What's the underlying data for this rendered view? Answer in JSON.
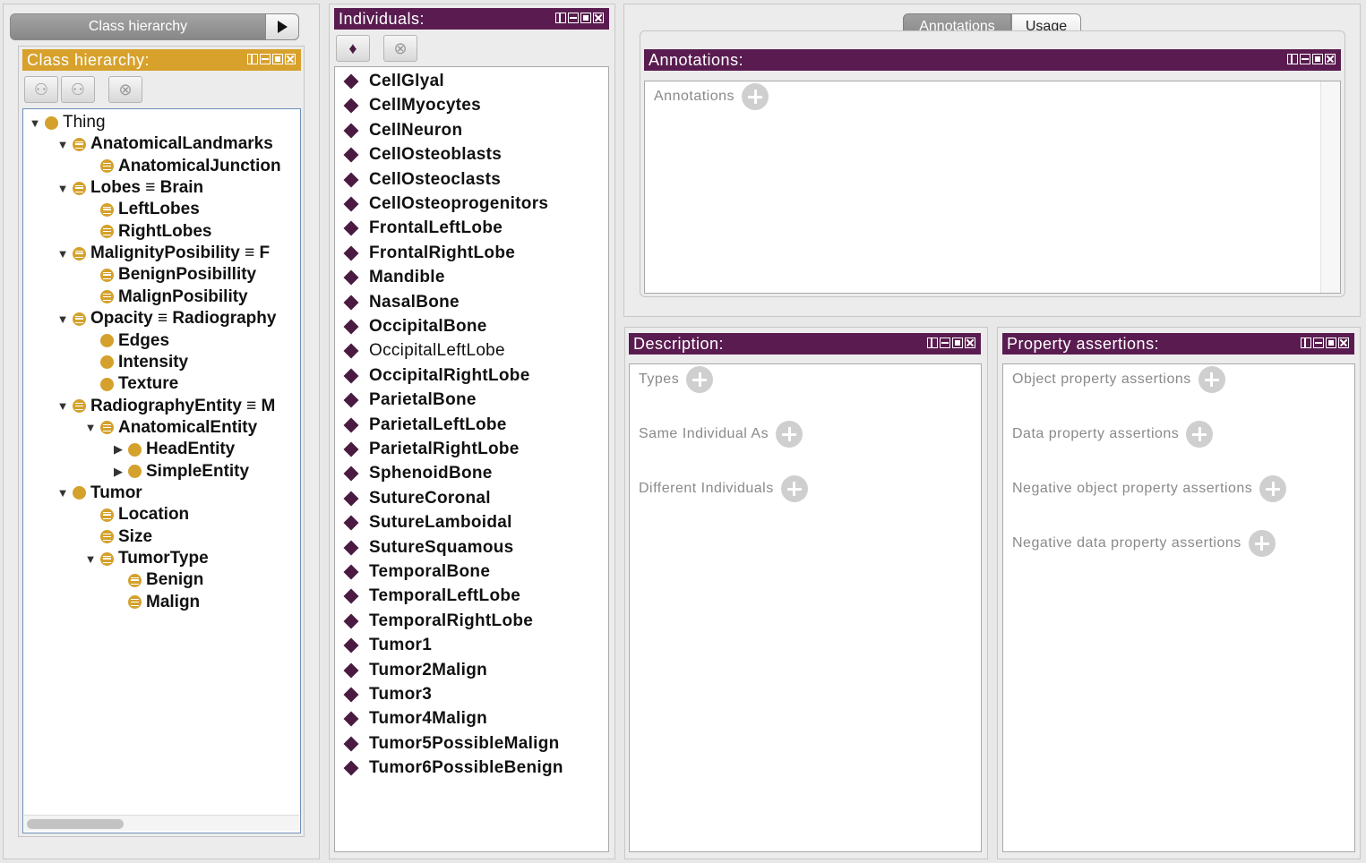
{
  "left_tab": {
    "label": "Class hierarchy"
  },
  "class_panel": {
    "title": "Class hierarchy:",
    "tree": [
      {
        "label": "Thing",
        "level": 0,
        "expander": "open",
        "dot": "plain",
        "bold": false
      },
      {
        "label": "AnatomicalLandmarks",
        "level": 1,
        "expander": "open",
        "dot": "eq",
        "bold": true
      },
      {
        "label": "AnatomicalJunction",
        "level": 2,
        "expander": "",
        "dot": "eq",
        "bold": true
      },
      {
        "label": "Lobes ≡ Brain",
        "level": 1,
        "expander": "open",
        "dot": "eq",
        "bold": true
      },
      {
        "label": "LeftLobes",
        "level": 2,
        "expander": "",
        "dot": "eq",
        "bold": true
      },
      {
        "label": "RightLobes",
        "level": 2,
        "expander": "",
        "dot": "eq",
        "bold": true
      },
      {
        "label": "MalignityPosibility ≡ F",
        "level": 1,
        "expander": "open",
        "dot": "eq",
        "bold": true
      },
      {
        "label": "BenignPosibillity",
        "level": 2,
        "expander": "",
        "dot": "eq",
        "bold": true
      },
      {
        "label": "MalignPosibility",
        "level": 2,
        "expander": "",
        "dot": "eq",
        "bold": true
      },
      {
        "label": "Opacity ≡ Radiography",
        "level": 1,
        "expander": "open",
        "dot": "eq",
        "bold": true
      },
      {
        "label": "Edges",
        "level": 2,
        "expander": "",
        "dot": "plain",
        "bold": true
      },
      {
        "label": "Intensity",
        "level": 2,
        "expander": "",
        "dot": "plain",
        "bold": true
      },
      {
        "label": "Texture",
        "level": 2,
        "expander": "",
        "dot": "plain",
        "bold": true
      },
      {
        "label": "RadiographyEntity ≡ M",
        "level": 1,
        "expander": "open",
        "dot": "eq",
        "bold": true
      },
      {
        "label": "AnatomicalEntity",
        "level": 2,
        "expander": "open",
        "dot": "eq",
        "bold": true
      },
      {
        "label": "HeadEntity",
        "level": 3,
        "expander": "closed",
        "dot": "plain",
        "bold": true
      },
      {
        "label": "SimpleEntity",
        "level": 3,
        "expander": "closed",
        "dot": "plain",
        "bold": true
      },
      {
        "label": "Tumor",
        "level": 1,
        "expander": "open",
        "dot": "plain",
        "bold": true
      },
      {
        "label": "Location",
        "level": 2,
        "expander": "",
        "dot": "eq",
        "bold": true
      },
      {
        "label": "Size",
        "level": 2,
        "expander": "",
        "dot": "eq",
        "bold": true
      },
      {
        "label": "TumorType",
        "level": 2,
        "expander": "open",
        "dot": "eq",
        "bold": true
      },
      {
        "label": "Benign",
        "level": 3,
        "expander": "",
        "dot": "eq",
        "bold": true
      },
      {
        "label": "Malign",
        "level": 3,
        "expander": "",
        "dot": "eq",
        "bold": true
      }
    ]
  },
  "individuals_panel": {
    "title": "Individuals:",
    "items": [
      {
        "label": "CellGlyal",
        "bold": true
      },
      {
        "label": "CellMyocytes",
        "bold": true
      },
      {
        "label": "CellNeuron",
        "bold": true
      },
      {
        "label": "CellOsteoblasts",
        "bold": true
      },
      {
        "label": "CellOsteoclasts",
        "bold": true
      },
      {
        "label": "CellOsteoprogenitors",
        "bold": true
      },
      {
        "label": "FrontalLeftLobe",
        "bold": true
      },
      {
        "label": "FrontalRightLobe",
        "bold": true
      },
      {
        "label": "Mandible",
        "bold": true
      },
      {
        "label": "NasalBone",
        "bold": true
      },
      {
        "label": "OccipitalBone",
        "bold": true
      },
      {
        "label": "OccipitalLeftLobe",
        "bold": false
      },
      {
        "label": "OccipitalRightLobe",
        "bold": true
      },
      {
        "label": "ParietalBone",
        "bold": true
      },
      {
        "label": "ParietalLeftLobe",
        "bold": true
      },
      {
        "label": "ParietalRightLobe",
        "bold": true
      },
      {
        "label": "SphenoidBone",
        "bold": true
      },
      {
        "label": "SutureCoronal",
        "bold": true
      },
      {
        "label": "SutureLamboidal",
        "bold": true
      },
      {
        "label": "SutureSquamous",
        "bold": true
      },
      {
        "label": "TemporalBone",
        "bold": true
      },
      {
        "label": "TemporalLeftLobe",
        "bold": true
      },
      {
        "label": "TemporalRightLobe",
        "bold": true
      },
      {
        "label": "Tumor1",
        "bold": true
      },
      {
        "label": "Tumor2Malign",
        "bold": true
      },
      {
        "label": "Tumor3",
        "bold": true
      },
      {
        "label": "Tumor4Malign",
        "bold": true
      },
      {
        "label": "Tumor5PossibleMalign",
        "bold": true
      },
      {
        "label": "Tumor6PossibleBenign",
        "bold": true
      }
    ]
  },
  "right_tabs": {
    "annotations": "Annotations",
    "usage": "Usage"
  },
  "annotations_panel": {
    "title": "Annotations:",
    "row_label": "Annotations"
  },
  "description_panel": {
    "title": "Description:",
    "sections": [
      "Types",
      "Same Individual As",
      "Different Individuals"
    ]
  },
  "property_panel": {
    "title": "Property assertions:",
    "sections": [
      "Object property assertions",
      "Data property assertions",
      "Negative object property assertions",
      "Negative data property assertions"
    ]
  },
  "colors": {
    "header_purple": "#5a1c50",
    "header_gold": "#d7a12c",
    "class_dot": "#d4a12c",
    "individual_diamond": "#4a1a43"
  }
}
